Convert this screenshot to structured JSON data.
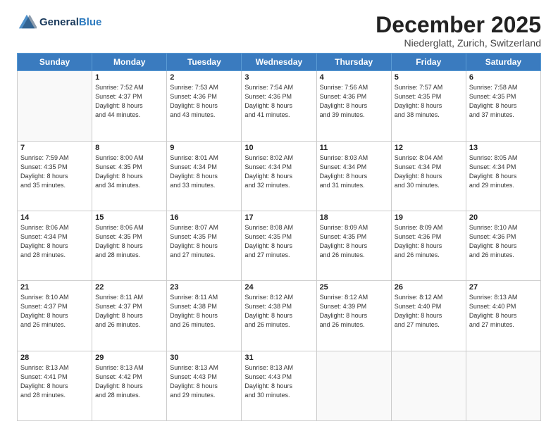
{
  "logo": {
    "line1": "General",
    "line2": "Blue"
  },
  "title": "December 2025",
  "location": "Niederglatt, Zurich, Switzerland",
  "weekdays": [
    "Sunday",
    "Monday",
    "Tuesday",
    "Wednesday",
    "Thursday",
    "Friday",
    "Saturday"
  ],
  "weeks": [
    [
      {
        "day": "",
        "info": ""
      },
      {
        "day": "1",
        "info": "Sunrise: 7:52 AM\nSunset: 4:37 PM\nDaylight: 8 hours\nand 44 minutes."
      },
      {
        "day": "2",
        "info": "Sunrise: 7:53 AM\nSunset: 4:36 PM\nDaylight: 8 hours\nand 43 minutes."
      },
      {
        "day": "3",
        "info": "Sunrise: 7:54 AM\nSunset: 4:36 PM\nDaylight: 8 hours\nand 41 minutes."
      },
      {
        "day": "4",
        "info": "Sunrise: 7:56 AM\nSunset: 4:36 PM\nDaylight: 8 hours\nand 39 minutes."
      },
      {
        "day": "5",
        "info": "Sunrise: 7:57 AM\nSunset: 4:35 PM\nDaylight: 8 hours\nand 38 minutes."
      },
      {
        "day": "6",
        "info": "Sunrise: 7:58 AM\nSunset: 4:35 PM\nDaylight: 8 hours\nand 37 minutes."
      }
    ],
    [
      {
        "day": "7",
        "info": "Sunrise: 7:59 AM\nSunset: 4:35 PM\nDaylight: 8 hours\nand 35 minutes."
      },
      {
        "day": "8",
        "info": "Sunrise: 8:00 AM\nSunset: 4:35 PM\nDaylight: 8 hours\nand 34 minutes."
      },
      {
        "day": "9",
        "info": "Sunrise: 8:01 AM\nSunset: 4:34 PM\nDaylight: 8 hours\nand 33 minutes."
      },
      {
        "day": "10",
        "info": "Sunrise: 8:02 AM\nSunset: 4:34 PM\nDaylight: 8 hours\nand 32 minutes."
      },
      {
        "day": "11",
        "info": "Sunrise: 8:03 AM\nSunset: 4:34 PM\nDaylight: 8 hours\nand 31 minutes."
      },
      {
        "day": "12",
        "info": "Sunrise: 8:04 AM\nSunset: 4:34 PM\nDaylight: 8 hours\nand 30 minutes."
      },
      {
        "day": "13",
        "info": "Sunrise: 8:05 AM\nSunset: 4:34 PM\nDaylight: 8 hours\nand 29 minutes."
      }
    ],
    [
      {
        "day": "14",
        "info": "Sunrise: 8:06 AM\nSunset: 4:34 PM\nDaylight: 8 hours\nand 28 minutes."
      },
      {
        "day": "15",
        "info": "Sunrise: 8:06 AM\nSunset: 4:35 PM\nDaylight: 8 hours\nand 28 minutes."
      },
      {
        "day": "16",
        "info": "Sunrise: 8:07 AM\nSunset: 4:35 PM\nDaylight: 8 hours\nand 27 minutes."
      },
      {
        "day": "17",
        "info": "Sunrise: 8:08 AM\nSunset: 4:35 PM\nDaylight: 8 hours\nand 27 minutes."
      },
      {
        "day": "18",
        "info": "Sunrise: 8:09 AM\nSunset: 4:35 PM\nDaylight: 8 hours\nand 26 minutes."
      },
      {
        "day": "19",
        "info": "Sunrise: 8:09 AM\nSunset: 4:36 PM\nDaylight: 8 hours\nand 26 minutes."
      },
      {
        "day": "20",
        "info": "Sunrise: 8:10 AM\nSunset: 4:36 PM\nDaylight: 8 hours\nand 26 minutes."
      }
    ],
    [
      {
        "day": "21",
        "info": "Sunrise: 8:10 AM\nSunset: 4:37 PM\nDaylight: 8 hours\nand 26 minutes."
      },
      {
        "day": "22",
        "info": "Sunrise: 8:11 AM\nSunset: 4:37 PM\nDaylight: 8 hours\nand 26 minutes."
      },
      {
        "day": "23",
        "info": "Sunrise: 8:11 AM\nSunset: 4:38 PM\nDaylight: 8 hours\nand 26 minutes."
      },
      {
        "day": "24",
        "info": "Sunrise: 8:12 AM\nSunset: 4:38 PM\nDaylight: 8 hours\nand 26 minutes."
      },
      {
        "day": "25",
        "info": "Sunrise: 8:12 AM\nSunset: 4:39 PM\nDaylight: 8 hours\nand 26 minutes."
      },
      {
        "day": "26",
        "info": "Sunrise: 8:12 AM\nSunset: 4:40 PM\nDaylight: 8 hours\nand 27 minutes."
      },
      {
        "day": "27",
        "info": "Sunrise: 8:13 AM\nSunset: 4:40 PM\nDaylight: 8 hours\nand 27 minutes."
      }
    ],
    [
      {
        "day": "28",
        "info": "Sunrise: 8:13 AM\nSunset: 4:41 PM\nDaylight: 8 hours\nand 28 minutes."
      },
      {
        "day": "29",
        "info": "Sunrise: 8:13 AM\nSunset: 4:42 PM\nDaylight: 8 hours\nand 28 minutes."
      },
      {
        "day": "30",
        "info": "Sunrise: 8:13 AM\nSunset: 4:43 PM\nDaylight: 8 hours\nand 29 minutes."
      },
      {
        "day": "31",
        "info": "Sunrise: 8:13 AM\nSunset: 4:43 PM\nDaylight: 8 hours\nand 30 minutes."
      },
      {
        "day": "",
        "info": ""
      },
      {
        "day": "",
        "info": ""
      },
      {
        "day": "",
        "info": ""
      }
    ]
  ]
}
